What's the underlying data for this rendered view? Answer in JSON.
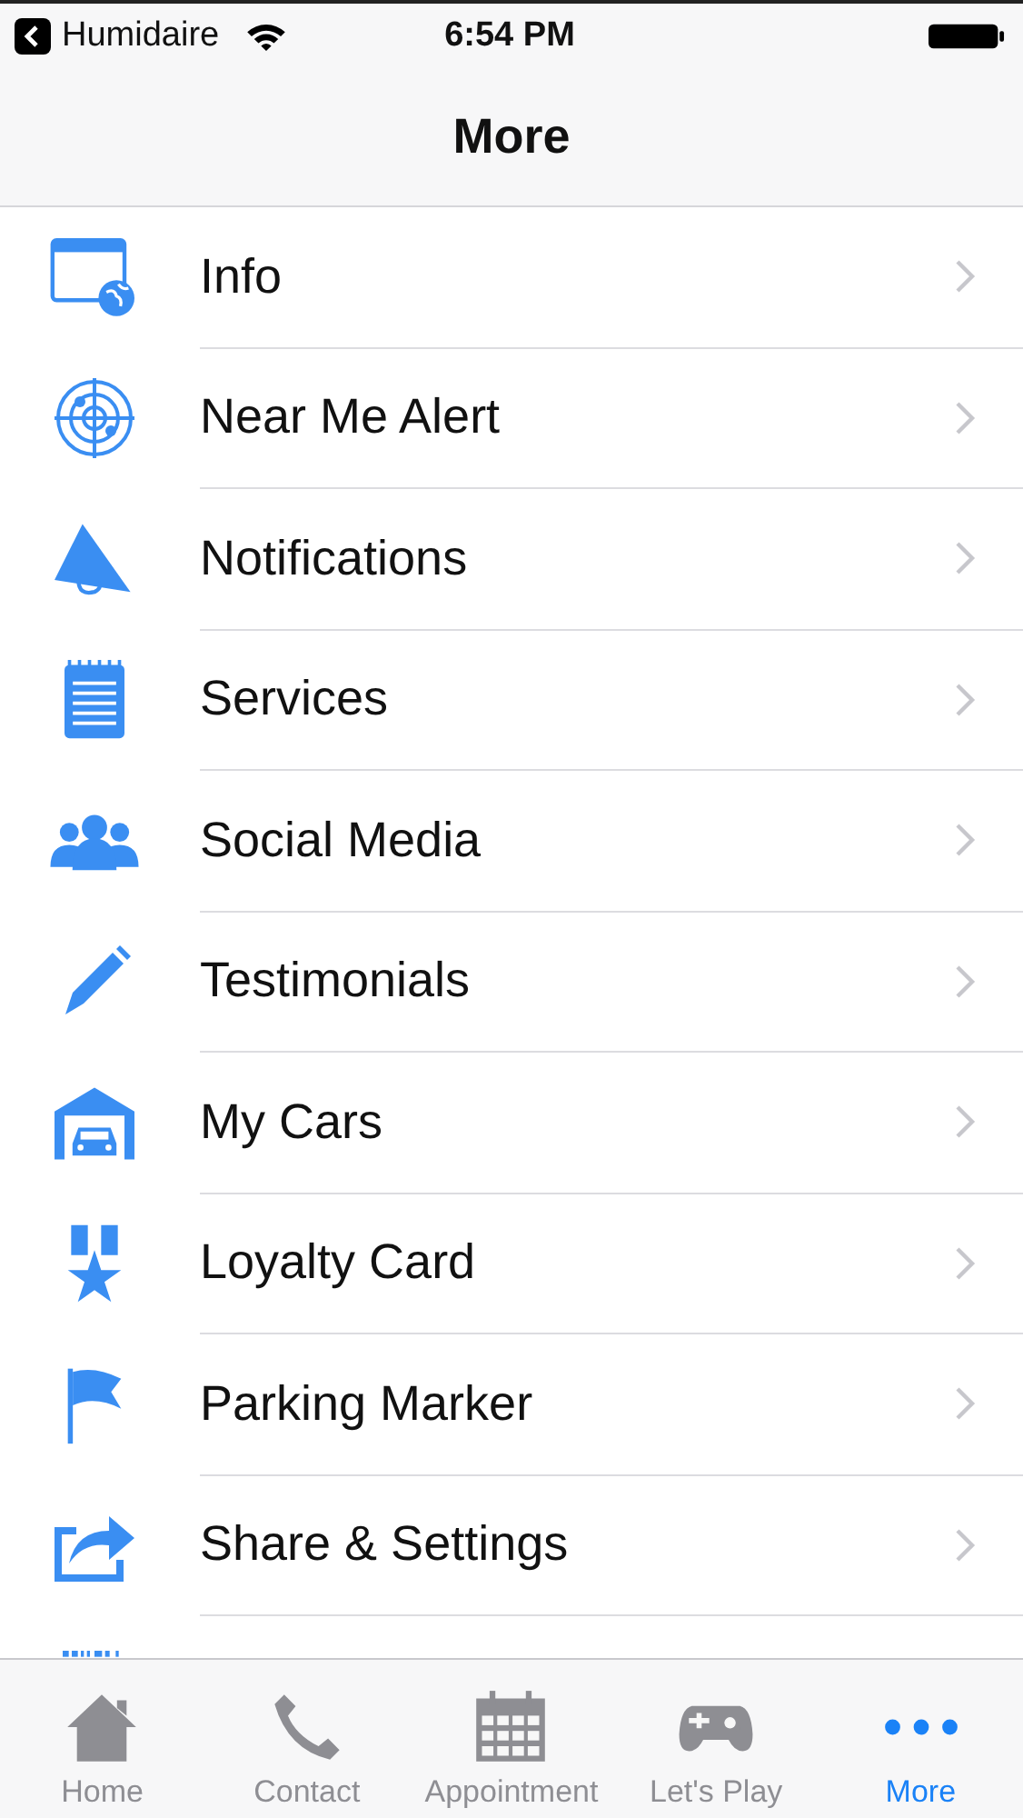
{
  "status_bar": {
    "back_app": "Humidaire",
    "time": "6:54 PM"
  },
  "nav_bar": {
    "title": "More"
  },
  "items": [
    {
      "label": "Info"
    },
    {
      "label": "Near Me Alert"
    },
    {
      "label": "Notifications"
    },
    {
      "label": "Services"
    },
    {
      "label": "Social Media"
    },
    {
      "label": "Testimonials"
    },
    {
      "label": "My Cars"
    },
    {
      "label": "Loyalty Card"
    },
    {
      "label": "Parking Marker"
    },
    {
      "label": "Share & Settings"
    }
  ],
  "tabs": [
    {
      "label": "Home",
      "selected": false
    },
    {
      "label": "Contact",
      "selected": false
    },
    {
      "label": "Appointment",
      "selected": false
    },
    {
      "label": "Let's Play",
      "selected": false
    },
    {
      "label": "More",
      "selected": true
    }
  ]
}
